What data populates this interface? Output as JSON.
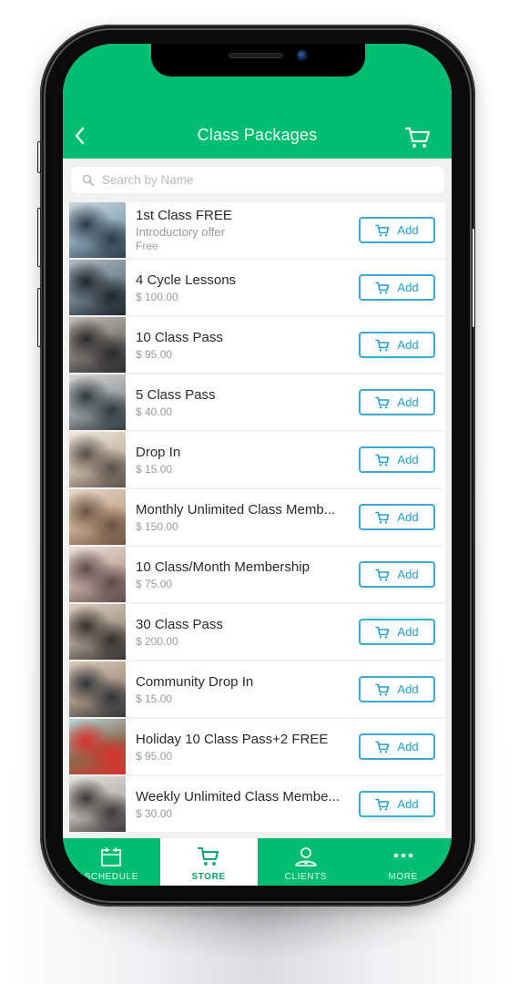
{
  "header": {
    "title": "Class Packages",
    "back_icon": "chevron-left-icon",
    "cart_icon": "shopping-cart-icon"
  },
  "search": {
    "placeholder": "Search by Name",
    "value": ""
  },
  "colors": {
    "brand_green": "#00bd72",
    "button_blue": "#1f9fd4",
    "price_gray": "#9a9a9a"
  },
  "packages": [
    {
      "name": "1st Class FREE",
      "subtitle": "Introductory offer",
      "price": "Free",
      "button": "Add",
      "thumb": [
        "#8aa6b8",
        "#2d3b48",
        "#c9d6de"
      ]
    },
    {
      "name": "4 Cycle Lessons",
      "price": "$ 100.00",
      "button": "Add",
      "thumb": [
        "#6e7f8c",
        "#1f262c",
        "#aeb8bf"
      ]
    },
    {
      "name": "10 Class Pass",
      "price": "$ 95.00",
      "button": "Add",
      "thumb": [
        "#7d7a76",
        "#2b2a2b",
        "#c1bbb4"
      ]
    },
    {
      "name": "5 Class Pass",
      "price": "$ 40.00",
      "button": "Add",
      "thumb": [
        "#9a9da0",
        "#2f3b3f",
        "#d5d6d5"
      ]
    },
    {
      "name": "Drop In",
      "price": "$ 15.00",
      "button": "Add",
      "thumb": [
        "#c8b9a8",
        "#5a4f48",
        "#ede6dc"
      ]
    },
    {
      "name": "Monthly Unlimited Class Memb...",
      "price": "$ 150.00",
      "button": "Add",
      "thumb": [
        "#c6a98f",
        "#6d5342",
        "#e7d8ca"
      ]
    },
    {
      "name": "10 Class/Month Membership",
      "price": "$ 75.00",
      "button": "Add",
      "thumb": [
        "#c0a8a0",
        "#5d4a48",
        "#ece0d8"
      ]
    },
    {
      "name": "30 Class Pass",
      "price": "$ 200.00",
      "button": "Add",
      "thumb": [
        "#a7988c",
        "#33302e",
        "#dccdbd"
      ]
    },
    {
      "name": "Community Drop In",
      "price": "$ 15.00",
      "button": "Add",
      "thumb": [
        "#a99582",
        "#2f3438",
        "#d9cab8"
      ]
    },
    {
      "name": "Holiday 10 Class Pass+2 FREE",
      "price": "$ 95.00",
      "button": "Add",
      "thumb": [
        "#8b6a4e",
        "#d8302c",
        "#b6d8dc"
      ]
    },
    {
      "name": "Weekly Unlimited Class Membe...",
      "price": "$ 30.00",
      "button": "Add",
      "thumb": [
        "#b9b6b2",
        "#3a3838",
        "#e2e0dc"
      ]
    }
  ],
  "tabbar": {
    "active": "STORE",
    "tabs": [
      {
        "label": "SCHEDULE",
        "icon": "calendar-icon"
      },
      {
        "label": "STORE",
        "icon": "shopping-cart-icon"
      },
      {
        "label": "CLIENTS",
        "icon": "user-icon"
      },
      {
        "label": "MORE",
        "icon": "more-dots-icon"
      }
    ]
  }
}
